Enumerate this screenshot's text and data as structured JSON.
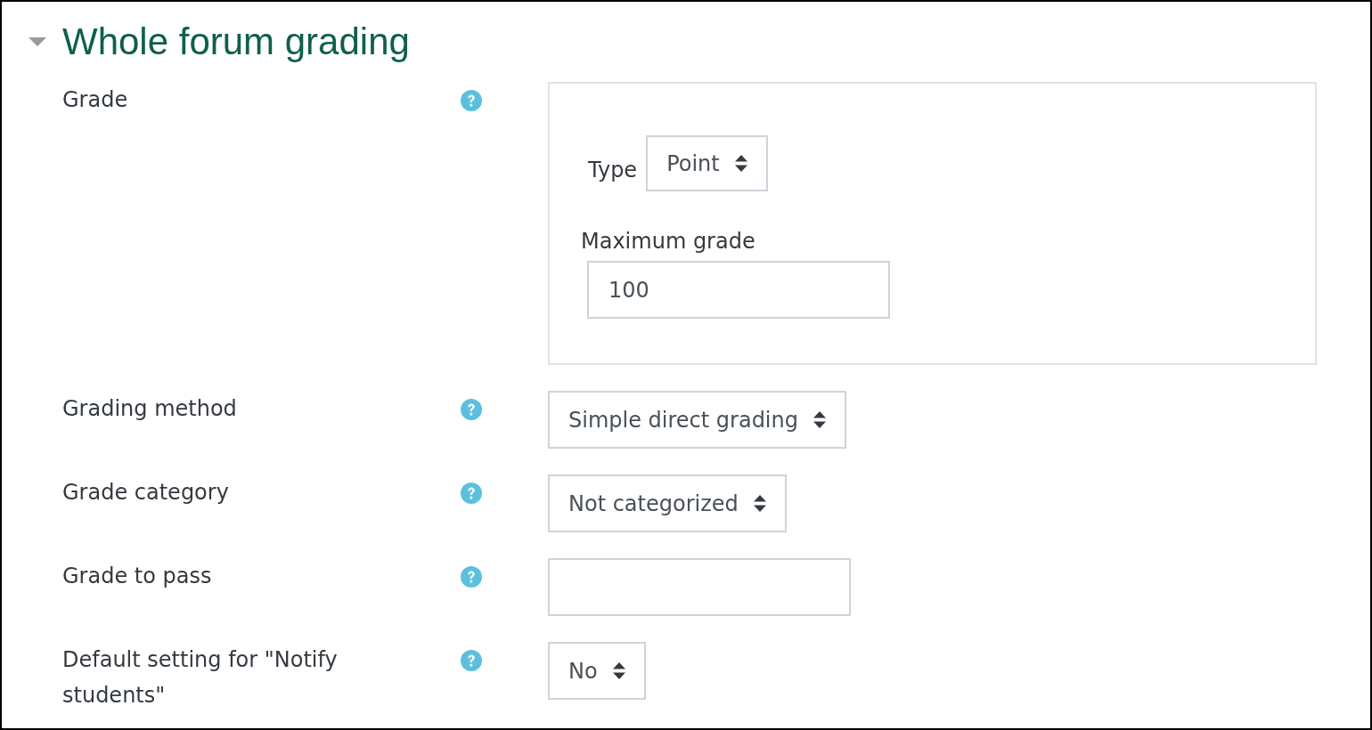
{
  "section": {
    "title": "Whole forum grading",
    "expanded": true
  },
  "fields": [
    {
      "kind": "group",
      "label": "Grade",
      "group": {
        "type": {
          "label": "Type",
          "value": "Point"
        },
        "maximum": {
          "label": "Maximum grade",
          "value": "100"
        }
      }
    },
    {
      "kind": "select",
      "label": "Grading method",
      "value": "Simple direct grading"
    },
    {
      "kind": "select",
      "label": "Grade category",
      "value": "Not categorized"
    },
    {
      "kind": "text",
      "label": "Grade to pass"
    },
    {
      "kind": "select",
      "label": "Default setting for \"Notify students\"",
      "value": "No"
    }
  ]
}
